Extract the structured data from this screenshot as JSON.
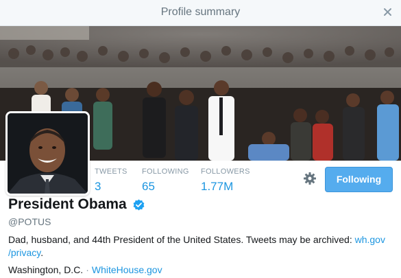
{
  "header": {
    "title": "Profile summary",
    "close_icon": "close-icon"
  },
  "profile": {
    "name": "President Obama",
    "verified": true,
    "handle": "@POTUS",
    "bio_text": "Dad, husband, and 44th President of the United States. Tweets may be archived: ",
    "bio_link_line1": "wh.gov",
    "bio_link_line2": "/privacy",
    "bio_end": ".",
    "location": "Washington, D.C.",
    "separator": "·",
    "website": "WhiteHouse.gov"
  },
  "stats": [
    {
      "label": "TWEETS",
      "value": "3"
    },
    {
      "label": "FOLLOWING",
      "value": "65"
    },
    {
      "label": "FOLLOWERS",
      "value": "1.77M"
    }
  ],
  "actions": {
    "follow_label": "Following",
    "settings_icon": "gear-icon"
  },
  "colors": {
    "accent": "#1b95e0",
    "button": "#55acee",
    "verified": "#1da1f2"
  }
}
